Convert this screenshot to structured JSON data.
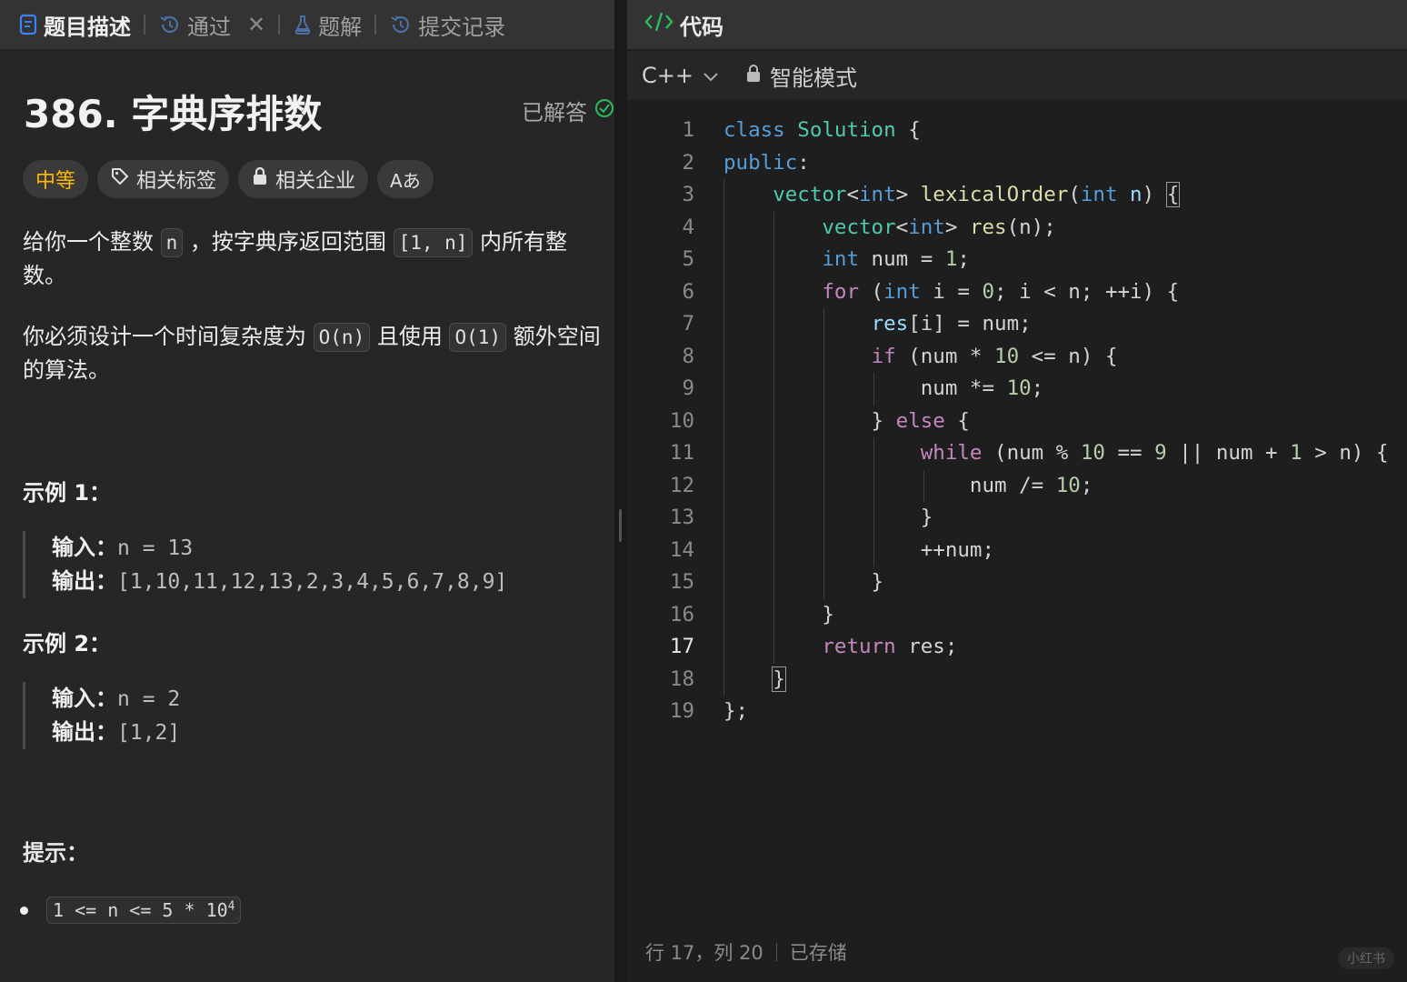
{
  "left_tabs": [
    {
      "label": "题目描述",
      "icon": "doc-icon",
      "active": true
    },
    {
      "label": "通过",
      "icon": "history-icon",
      "closable": true
    },
    {
      "label": "题解",
      "icon": "flask-icon"
    },
    {
      "label": "提交记录",
      "icon": "history-icon"
    }
  ],
  "problem": {
    "title": "386. 字典序排数",
    "solved_label": "已解答",
    "difficulty": "中等",
    "tags_label": "相关标签",
    "companies_label": "相关企业",
    "font_label": "Aあ",
    "desc1_a": "给你一个整数 ",
    "desc1_code1": "n",
    "desc1_b": " ，按字典序返回范围 ",
    "desc1_code2": "[1, n]",
    "desc1_c": " 内所有整数。",
    "desc2_a": "你必须设计一个时间复杂度为 ",
    "desc2_code1": "O(n)",
    "desc2_b": " 且使用 ",
    "desc2_code2": "O(1)",
    "desc2_c": " 额外空间的算法。",
    "example1_title": "示例 1：",
    "example1_input_label": "输入：",
    "example1_input": "n = 13",
    "example1_output_label": "输出：",
    "example1_output": "[1,10,11,12,13,2,3,4,5,6,7,8,9]",
    "example2_title": "示例 2：",
    "example2_input_label": "输入：",
    "example2_input": "n = 2",
    "example2_output_label": "输出：",
    "example2_output": "[1,2]",
    "hint_title": "提示：",
    "hint_code": "1 <= n <= 5 * 10",
    "hint_exp": "4"
  },
  "editor": {
    "header_title": "代码",
    "language": "C++",
    "mode": "智能模式",
    "current_line": 17,
    "status_position": "行 17，列 20",
    "status_saved": "已存储",
    "line_numbers": [
      "1",
      "2",
      "3",
      "4",
      "5",
      "6",
      "7",
      "8",
      "9",
      "10",
      "11",
      "12",
      "13",
      "14",
      "15",
      "16",
      "17",
      "18",
      "19"
    ]
  },
  "watermark": "小红书",
  "colors": {
    "difficulty": "#ffb800",
    "solved_check": "#2cbb5d",
    "keyword": "#569cd6",
    "type": "#4ec9b0"
  }
}
